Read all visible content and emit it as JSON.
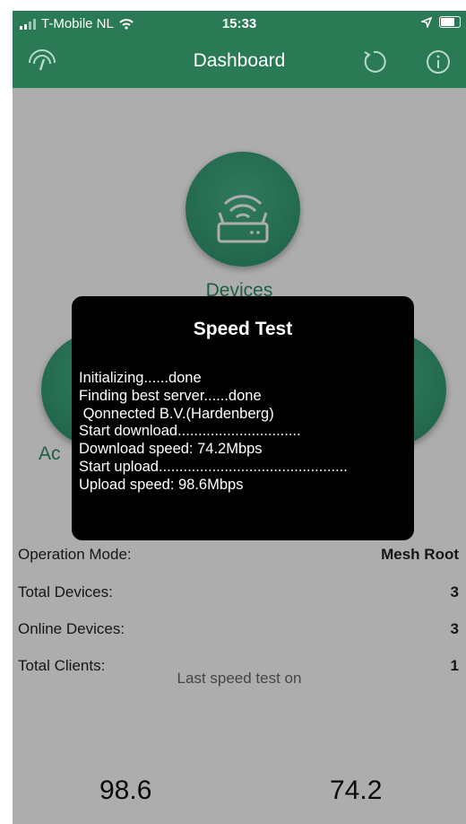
{
  "status_bar": {
    "carrier": "T-Mobile NL",
    "time": "15:33",
    "icons": [
      "signal-icon",
      "wifi-icon",
      "location-arrow-icon",
      "battery-icon"
    ]
  },
  "nav": {
    "title": "Dashboard",
    "left_icon": "speed-gauge-icon",
    "right_icons": [
      "refresh-icon",
      "info-icon"
    ],
    "bar_color": "#2a7a56"
  },
  "dashboard": {
    "devices_label": "Devices",
    "partial_label": "Ac",
    "info_rows": [
      {
        "label": "Operation Mode:",
        "value": "Mesh Root"
      },
      {
        "label": "Total Devices:",
        "value": "3"
      },
      {
        "label": "Online Devices:",
        "value": "3"
      },
      {
        "label": "Total Clients:",
        "value": "1"
      }
    ],
    "last_speed_test_label": "Last speed test on",
    "upload_value": "98.6",
    "download_value": "74.2",
    "accent_color": "#2e8b63"
  },
  "dialog": {
    "title": "Speed Test",
    "lines": [
      "Initializing......done",
      "Finding best server......done",
      " Qonnected B.V.(Hardenberg)",
      "Start download..............................",
      "Download speed: 74.2Mbps",
      "Start upload..............................................",
      "Upload speed: 98.6Mbps"
    ]
  }
}
